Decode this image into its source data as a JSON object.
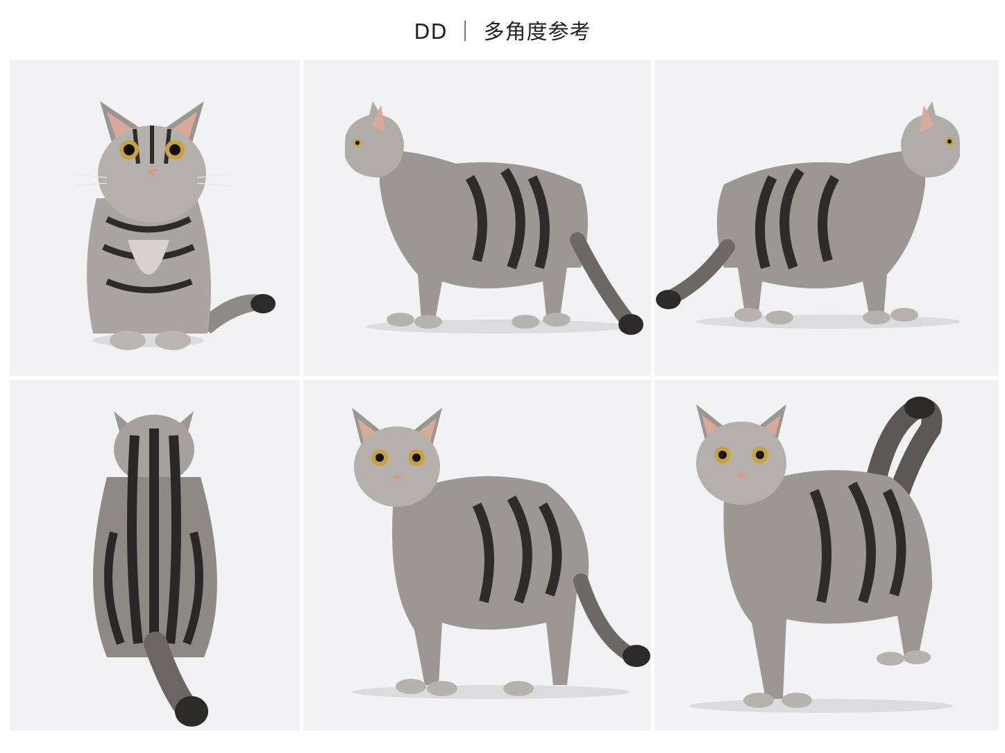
{
  "header": {
    "title": "DD ｜ 多角度参考"
  },
  "colors": {
    "panel_bg": "#f2f2f4",
    "fur_light": "#b9b6b2",
    "fur_dark": "#2e2c2b",
    "eye": "#c9a23a",
    "nose": "#d79a88",
    "ear_inner": "#d9a99a"
  },
  "panels": [
    {
      "name": "front-sitting"
    },
    {
      "name": "side-left-standing"
    },
    {
      "name": "side-right-standing"
    },
    {
      "name": "back-sitting"
    },
    {
      "name": "three-quarter-left"
    },
    {
      "name": "three-quarter-tail-up"
    }
  ]
}
